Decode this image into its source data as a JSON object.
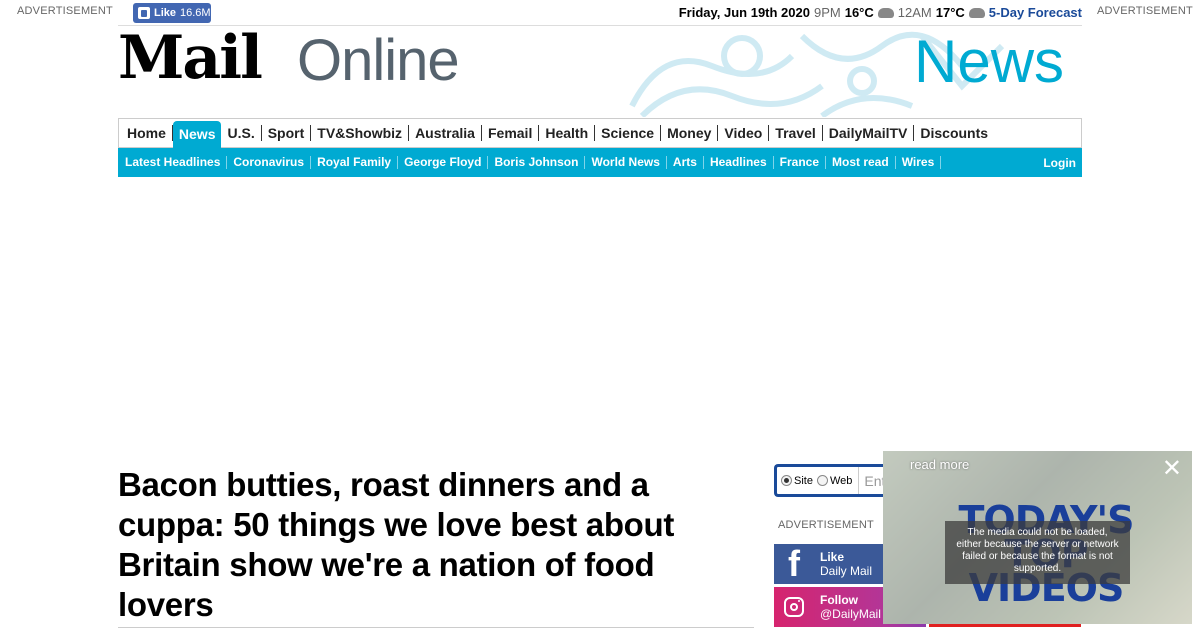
{
  "ads": {
    "left_label": "ADVERTISEMENT",
    "right_label": "ADVERTISEMENT",
    "side_label": "ADVERTISEMENT"
  },
  "facebook_like": {
    "label": "Like",
    "count": "16.6M"
  },
  "weather": {
    "date": "Friday, Jun 19th 2020",
    "time1": "9PM",
    "temp1": "16°C",
    "time2": "12AM",
    "temp2": "17°C",
    "forecast_link": "5-Day Forecast"
  },
  "masthead": {
    "logo_mail": "Mail",
    "logo_online": "Online",
    "channel": "News"
  },
  "nav": {
    "items": [
      "Home",
      "News",
      "U.S.",
      "Sport",
      "TV&Showbiz",
      "Australia",
      "Femail",
      "Health",
      "Science",
      "Money",
      "Video",
      "Travel",
      "DailyMailTV",
      "Discounts"
    ],
    "active": "News"
  },
  "subnav": {
    "items": [
      "Latest Headlines",
      "Coronavirus",
      "Royal Family",
      "George Floyd",
      "Boris Johnson",
      "World News",
      "Arts",
      "Headlines",
      "France",
      "Most read",
      "Wires"
    ],
    "login": "Login"
  },
  "article": {
    "headline": "Bacon butties, roast dinners and a cuppa: 50 things we love best about Britain show we're a nation of food lovers"
  },
  "search": {
    "option_site": "Site",
    "option_web": "Web",
    "placeholder": "Ent",
    "selected": "Site"
  },
  "social": {
    "facebook": {
      "action": "Like",
      "handle": "Daily Mail"
    },
    "instagram": {
      "action": "Follow",
      "handle": "@DailyMail"
    }
  },
  "video_overlay": {
    "read_more": "read more",
    "title": "TODAY'S TOP VIDEOS",
    "error": "The media could not be loaded, either because the server or network failed or because the format is not supported."
  },
  "colors": {
    "accent": "#00aad2",
    "fb": "#3b5998",
    "search_border": "#1a4a99"
  }
}
